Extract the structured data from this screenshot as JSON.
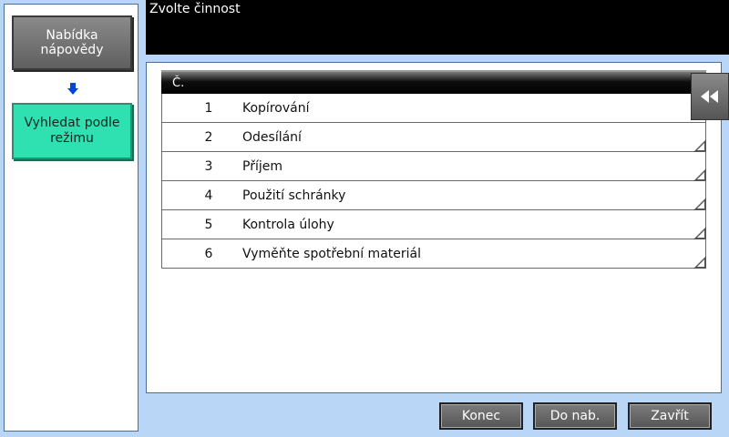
{
  "sidebar": {
    "help_menu_label": "Nabídka nápovědy",
    "mode_search_label": "Vyhledat podle režimu"
  },
  "header": {
    "title": "Zvolte činnost"
  },
  "table": {
    "header": "Č.",
    "rows": [
      {
        "num": "1",
        "label": "Kopírování"
      },
      {
        "num": "2",
        "label": "Odesílání"
      },
      {
        "num": "3",
        "label": "Příjem"
      },
      {
        "num": "4",
        "label": "Použití schránky"
      },
      {
        "num": "5",
        "label": "Kontrola úlohy"
      },
      {
        "num": "6",
        "label": "Vyměňte spotřební materiál"
      }
    ]
  },
  "footer": {
    "end_label": "Konec",
    "menu_label": "Do nab.",
    "close_label": "Zavřít"
  },
  "icons": {
    "arrow": "arrow-down-icon",
    "collapse": "double-chevron-left-icon"
  },
  "colors": {
    "background": "#b9d6f6",
    "mode_button": "#2fe0b0",
    "arrow": "#0047d6"
  }
}
